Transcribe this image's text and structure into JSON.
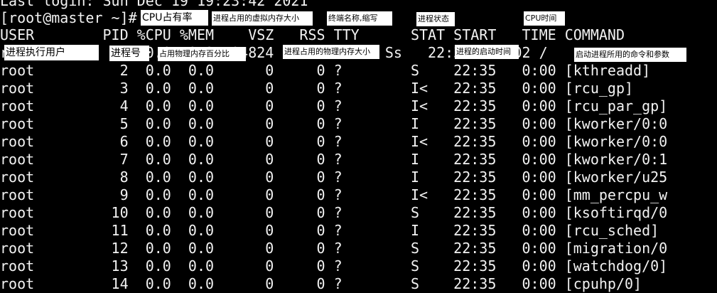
{
  "terminal": {
    "last_login": "Last login: Sun Dec 19 19:23:42 2021",
    "prompt": "[root@master ~]#",
    "header": "USER        PID %CPU %MEM    VSZ   RSS TTY      STAT START   TIME COMMAND",
    "rows": [
      "root          1  0.0  0.2 194824  4 ?        Ss   22:35   0:02 /",
      "root          2  0.0  0.0      0     0 ?        S    22:35   0:00 [kthreadd]",
      "root          3  0.0  0.0      0     0 ?        I<   22:35   0:00 [rcu_gp]",
      "root          4  0.0  0.0      0     0 ?        I<   22:35   0:00 [rcu_par_gp]",
      "root          5  0.0  0.0      0     0 ?        I    22:35   0:00 [kworker/0:0",
      "root          6  0.0  0.0      0     0 ?        I<   22:35   0:00 [kworker/0:0",
      "root          7  0.0  0.0      0     0 ?        I    22:35   0:00 [kworker/0:1",
      "root          8  0.0  0.0      0     0 ?        I    22:35   0:00 [kworker/u25",
      "root          9  0.0  0.0      0     0 ?        I<   22:35   0:00 [mm_percpu_w",
      "root         10  0.0  0.0      0     0 ?        S    22:35   0:00 [ksoftirqd/0",
      "root         11  0.0  0.0      0     0 ?        I    22:35   0:00 [rcu_sched]",
      "root         12  0.0  0.0      0     0 ?        S    22:35   0:00 [migration/0",
      "root         13  0.0  0.0      0     0 ?        S    22:35   0:00 [watchdog/0]",
      "root         14  0.0  0.0      0     0 ?        S    22:35   0:00 [cpuhp/0]"
    ]
  },
  "annotations": {
    "cpu_rate": "CPU占有率",
    "virtual_mem": "进程占用的虚拟内存大小",
    "terminal_name": "终端名称,缩写",
    "proc_state": "进程状态",
    "cpu_time": "CPU时间",
    "user": "进程执行用户",
    "pid": "进程号",
    "mem_pct": "占用物理内存百分比",
    "phys_mem": "进程占用的物理内存大小",
    "start_time": "进程的启动时间",
    "command": "启动进程所用的命令和参数"
  }
}
